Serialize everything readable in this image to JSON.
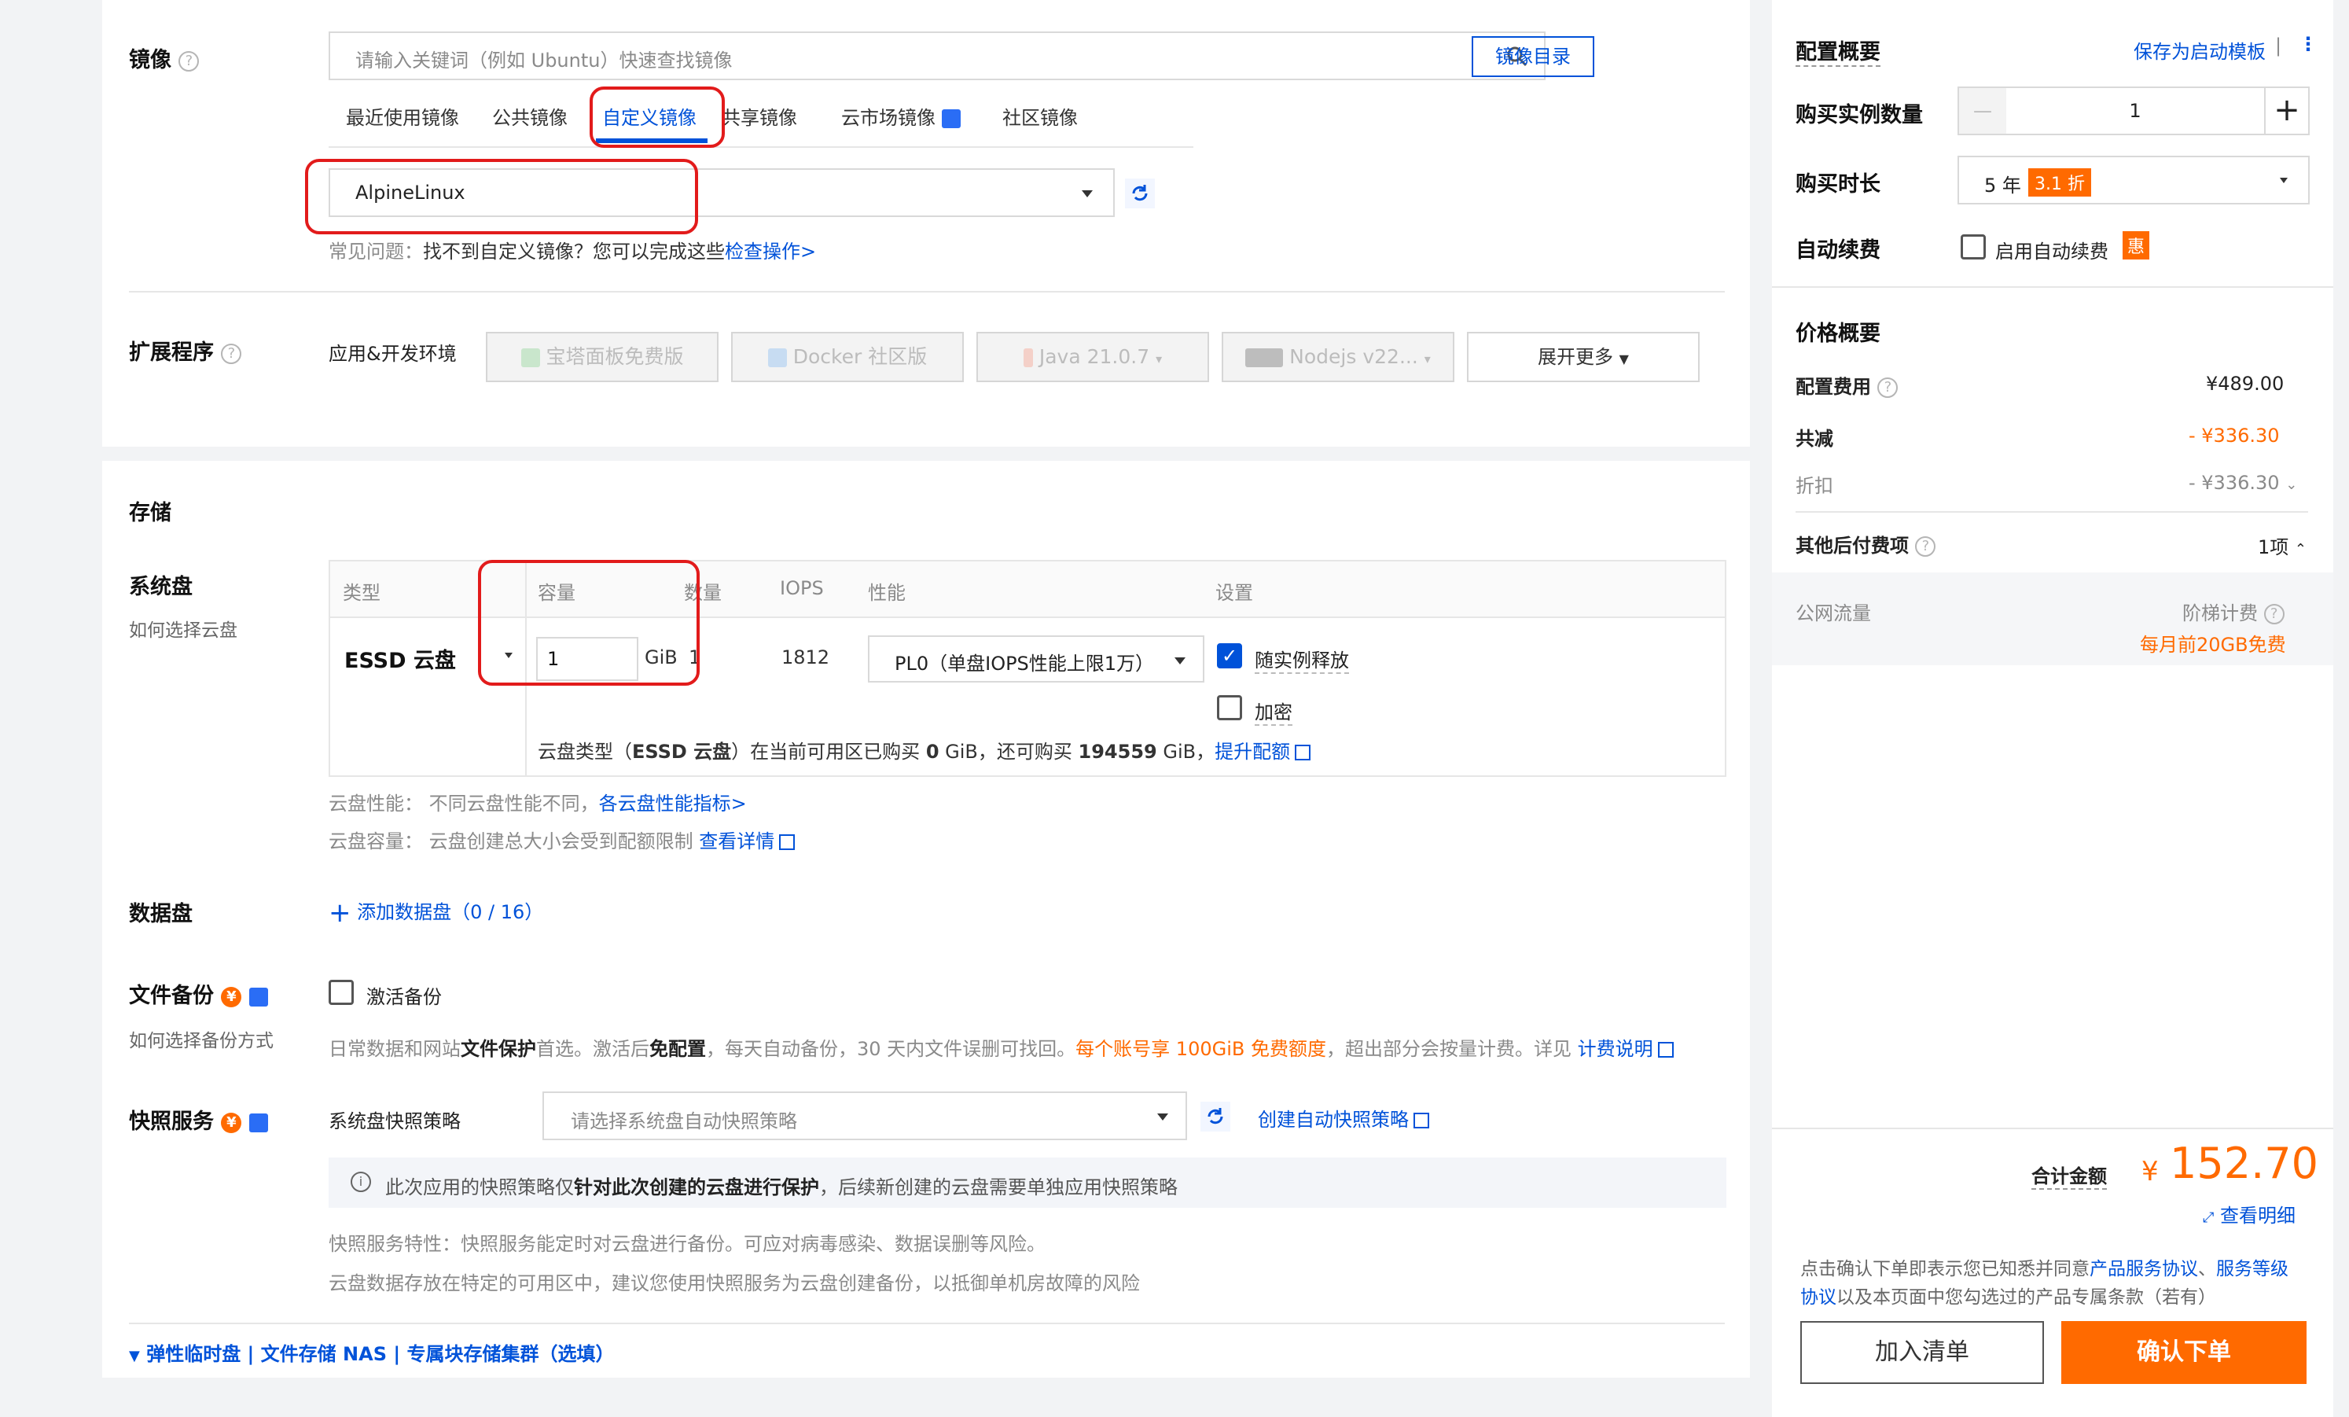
{
  "image_section": {
    "title": "镜像",
    "search_placeholder": "请输入关键词（例如 Ubuntu）快速查找镜像",
    "catalog_button": "镜像目录",
    "tabs": [
      "最近使用镜像",
      "公共镜像",
      "自定义镜像",
      "共享镜像",
      "云市场镜像",
      "社区镜像"
    ],
    "active_tab": "自定义镜像",
    "selected_image": "AlpineLinux",
    "faq_label": "常见问题：",
    "faq_text": "找不到自定义镜像？您可以完成这些",
    "faq_link": "检查操作>"
  },
  "extensions": {
    "title": "扩展程序",
    "env_label": "应用&开发环境",
    "apps": [
      "宝塔面板免费版",
      "Docker 社区版",
      "Java 21.0.7",
      "Nodejs v22..."
    ],
    "expand": "展开更多"
  },
  "storage": {
    "title": "存储",
    "system_disk": {
      "title": "系统盘",
      "help": "如何选择云盘",
      "headers": [
        "类型",
        "容量",
        "数量",
        "IOPS",
        "性能",
        "设置"
      ],
      "type": "ESSD 云盘",
      "capacity": "1",
      "unit": "GiB",
      "count": "1",
      "iops": "1812",
      "perf": "PL0（单盘IOPS性能上限1万）",
      "release_with_instance": "随实例释放",
      "encrypt": "加密",
      "quota_pre": "云盘类型（",
      "quota_type": "ESSD 云盘",
      "quota_mid1": "）在当前可用区已购买 ",
      "quota_bought": "0",
      "quota_mid2": " GiB，还可购买 ",
      "quota_avail": "194559",
      "quota_mid3": " GiB，",
      "quota_link": "提升配额",
      "perf_note_label": "云盘性能：",
      "perf_note": "不同云盘性能不同，",
      "perf_note_link": "各云盘性能指标>",
      "cap_note_label": "云盘容量：",
      "cap_note": "云盘创建总大小会受到配额限制",
      "cap_note_link": "查看详情"
    },
    "data_disk": {
      "title": "数据盘",
      "add": "添加数据盘（0 / 16）"
    },
    "file_backup": {
      "title": "文件备份",
      "help": "如何选择备份方式",
      "activate": "激活备份",
      "desc_a": "日常数据和网站",
      "desc_b": "文件保护",
      "desc_c": "首选。激活后",
      "desc_d": "免配置",
      "desc_e": "，每天自动备份，30 天内文件误删可找回。",
      "desc_f": "每个账号享 100GiB 免费额度",
      "desc_g": "，超出部分会按量计费。详见 ",
      "desc_link": "计费说明"
    },
    "snapshot": {
      "title": "快照服务",
      "policy_label": "系统盘快照策略",
      "policy_placeholder": "请选择系统盘自动快照策略",
      "create_link": "创建自动快照策略",
      "notice_a": "此次应用的快照策略仅",
      "notice_b": "针对此次创建的云盘进行保护",
      "notice_c": "，后续新创建的云盘需要单独应用快照策略",
      "feature": "快照服务特性：快照服务能定时对云盘进行备份。可应对病毒感染、数据误删等风险。",
      "advice": "云盘数据存放在特定的可用区中，建议您使用快照服务为云盘创建备份，以抵御单机房故障的风险"
    },
    "more_options": "弹性临时盘 | 文件存储 NAS | 专属块存储集群（选填）"
  },
  "summary": {
    "title": "配置概要",
    "save_template": "保存为启动模板",
    "qty_label": "购买实例数量",
    "qty_minus": "—",
    "qty_value": "1",
    "qty_plus": "+",
    "duration_label": "购买时长",
    "duration_value": "5 年",
    "duration_discount": "3.1 折",
    "renew_label": "自动续费",
    "renew_option": "启用自动续费",
    "renew_badge": "惠"
  },
  "price": {
    "title": "价格概要",
    "config_fee_label": "配置费用",
    "config_fee": "¥489.00",
    "total_reduce_label": "共减",
    "total_reduce": "- ¥336.30",
    "discount_label": "折扣",
    "discount": "- ¥336.30",
    "other_label": "其他后付费项",
    "other_value": "1项",
    "traffic_label": "公网流量",
    "traffic_value": "阶梯计费",
    "traffic_free": "每月前20GB免费"
  },
  "checkout": {
    "total_label": "合计金额",
    "currency": "¥",
    "total": "152.70",
    "detail_link": "查看明细",
    "agree_a": "点击确认下单即表示您已知悉并同意",
    "agree_link1": "产品服务协议",
    "agree_sep": "、",
    "agree_link2": "服务等级协议",
    "agree_b": "以及本页面中您勾选过的产品专属条款（若有）",
    "add_cart": "加入清单",
    "confirm": "确认下单"
  }
}
